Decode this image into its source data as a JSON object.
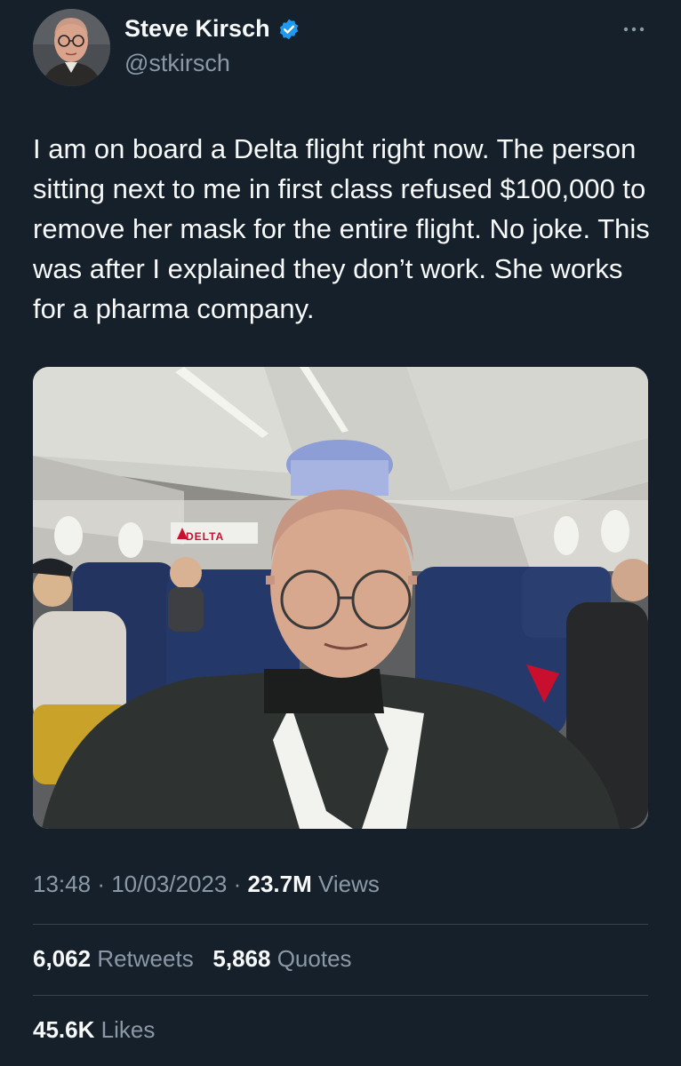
{
  "author": {
    "display_name": "Steve Kirsch",
    "handle": "@stkirsch",
    "verified": true,
    "verified_color": "#1d9bf0"
  },
  "tweet": {
    "text": "I am on board a Delta flight right now. The person sitting next to me in first class refused $100,000 to remove her mask for the entire flight. No joke. This was after I explained they don’t work. She works for a pharma company."
  },
  "media": {
    "sign_text": "DELTA"
  },
  "meta": {
    "time": "13:48",
    "date": "10/03/2023",
    "views_count": "23.7M",
    "views_label": "Views",
    "separator": "·"
  },
  "stats": {
    "retweets_count": "6,062",
    "retweets_label": "Retweets",
    "quotes_count": "5,868",
    "quotes_label": "Quotes",
    "likes_count": "45.6K",
    "likes_label": "Likes"
  },
  "icons": {
    "more": "more-horizontal-icon",
    "verified": "verified-badge-icon"
  },
  "colors": {
    "background": "#15202b",
    "text_primary": "#f7f9f9",
    "text_secondary": "#8b98a5",
    "divider": "#38444d"
  }
}
